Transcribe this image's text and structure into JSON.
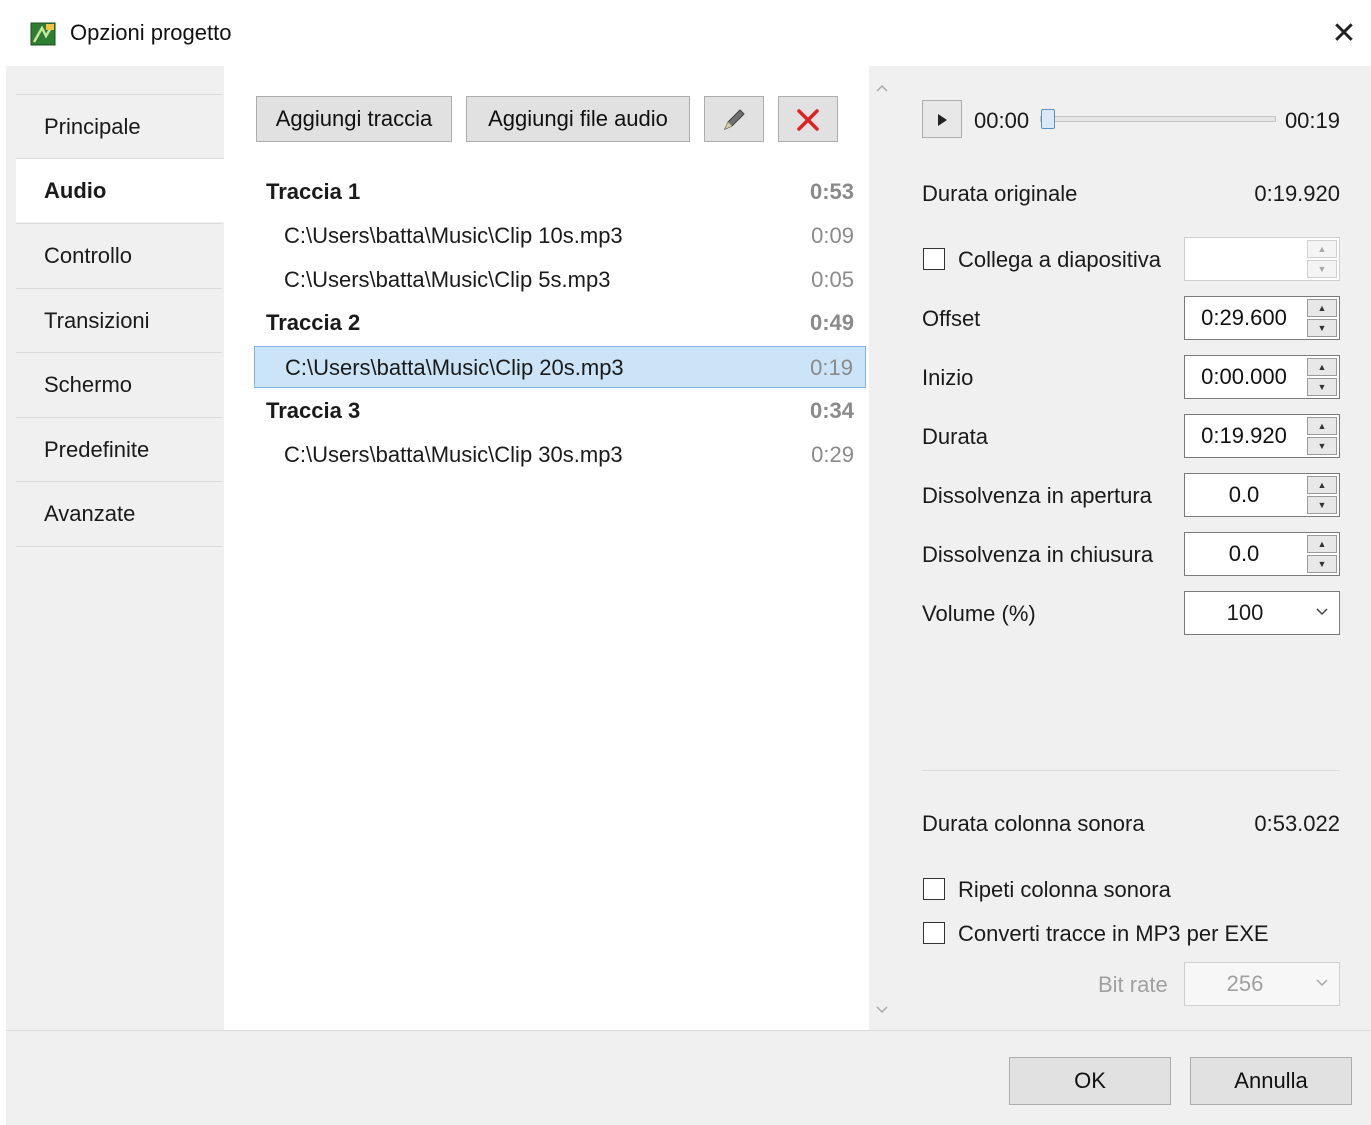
{
  "window": {
    "title": "Opzioni progetto",
    "close_glyph": "✕"
  },
  "sidebar": {
    "items": [
      {
        "label": "Principale"
      },
      {
        "label": "Audio"
      },
      {
        "label": "Controllo"
      },
      {
        "label": "Transizioni"
      },
      {
        "label": "Schermo"
      },
      {
        "label": "Predefinite"
      },
      {
        "label": "Avanzate"
      }
    ],
    "active_index": 1
  },
  "toolbar": {
    "add_track_label": "Aggiungi traccia",
    "add_audio_label": "Aggiungi file audio",
    "edit_icon": "pencil-icon",
    "delete_icon": "delete-x-icon",
    "delete_color": "#e02020"
  },
  "tracks": [
    {
      "name": "Traccia 1",
      "duration": "0:53",
      "files": [
        {
          "path": "C:\\Users\\batta\\Music\\Clip 10s.mp3",
          "duration": "0:09"
        },
        {
          "path": "C:\\Users\\batta\\Music\\Clip 5s.mp3",
          "duration": "0:05"
        }
      ]
    },
    {
      "name": "Traccia 2",
      "duration": "0:49",
      "files": [
        {
          "path": "C:\\Users\\batta\\Music\\Clip 20s.mp3",
          "duration": "0:19",
          "selected": true
        }
      ]
    },
    {
      "name": "Traccia 3",
      "duration": "0:34",
      "files": [
        {
          "path": "C:\\Users\\batta\\Music\\Clip 30s.mp3",
          "duration": "0:29"
        }
      ]
    }
  ],
  "player": {
    "current": "00:00",
    "total": "00:19",
    "position_fraction": 0.0
  },
  "props": {
    "durata_originale_label": "Durata originale",
    "durata_originale_value": "0:19.920",
    "collega_label": "Collega a diapositiva",
    "collega_checked": false,
    "collega_value": "",
    "offset_label": "Offset",
    "offset_value": "0:29.600",
    "inizio_label": "Inizio",
    "inizio_value": "0:00.000",
    "durata_label": "Durata",
    "durata_value": "0:19.920",
    "fade_in_label": "Dissolvenza in apertura",
    "fade_in_value": "0.0",
    "fade_out_label": "Dissolvenza in chiusura",
    "fade_out_value": "0.0",
    "volume_label": "Volume (%)",
    "volume_value": "100"
  },
  "soundtrack": {
    "durata_label": "Durata colonna sonora",
    "durata_value": "0:53.022",
    "repeat_label": "Ripeti colonna sonora",
    "repeat_checked": false,
    "convert_label": "Converti tracce in MP3 per EXE",
    "convert_checked": false,
    "bitrate_label": "Bit rate",
    "bitrate_value": "256"
  },
  "footer": {
    "ok_label": "OK",
    "cancel_label": "Annulla"
  }
}
